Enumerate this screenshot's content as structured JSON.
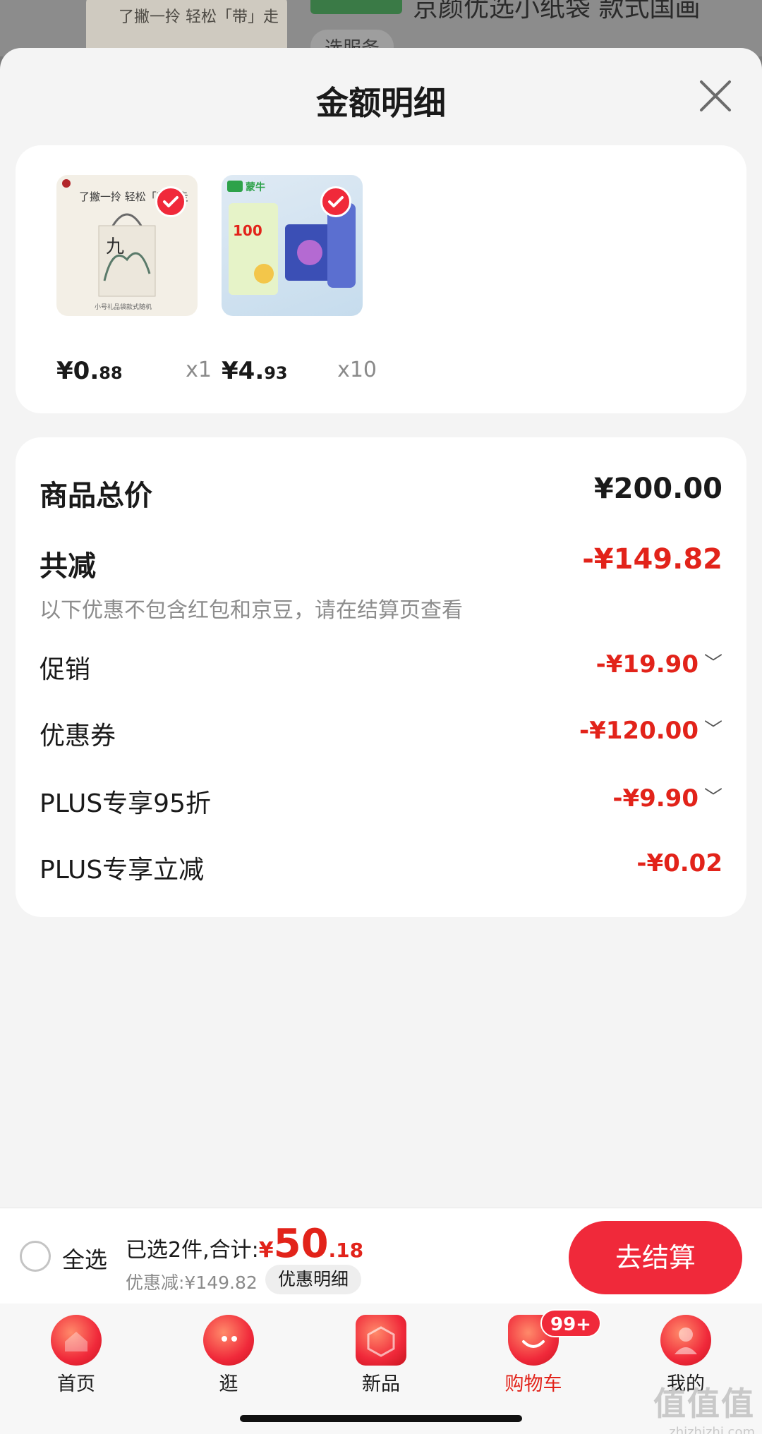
{
  "background_page": {
    "thumb_text": "了撇一拎 轻松「带」走",
    "product_title": "京颜优选小纸袋 款式国画",
    "spec_chip": "选服务"
  },
  "sheet": {
    "title": "金额明细",
    "close_icon": "close-icon"
  },
  "products": [
    {
      "image_text": "了撇一拎 轻松「带」走",
      "image_caption": "小号礼品袋款式随机",
      "price_int": "¥0.",
      "price_dec": "88",
      "qty": "x1",
      "checked": true
    },
    {
      "image_text": "蒙牛",
      "image_caption": "100",
      "price_int": "¥4.",
      "price_dec": "93",
      "qty": "x10",
      "checked": true
    }
  ],
  "breakdown": {
    "total_label": "商品总价",
    "total_value": "¥200.00",
    "reduce_label": "共减",
    "reduce_value": "-¥149.82",
    "note": "以下优惠不包含红包和京豆，请在结算页查看",
    "items": [
      {
        "label": "促销",
        "value": "-¥19.90",
        "expandable": true
      },
      {
        "label": "优惠券",
        "value": "-¥120.00",
        "expandable": true
      },
      {
        "label": "PLUS专享95折",
        "value": "-¥9.90",
        "expandable": true
      },
      {
        "label": "PLUS专享立减",
        "value": "-¥0.02",
        "expandable": false
      }
    ]
  },
  "bottom_bar": {
    "select_all": "全选",
    "selected_text": "已选2件,合计:",
    "total_symbol": "¥",
    "total_int": "50",
    "total_dec": ".18",
    "discount_text": "优惠减:¥149.82",
    "detail_chip": "优惠明细",
    "checkout": "去结算"
  },
  "tabbar": {
    "tabs": [
      {
        "label": "首页",
        "icon": "home-icon",
        "active": false
      },
      {
        "label": "逛",
        "icon": "browse-icon",
        "active": false
      },
      {
        "label": "新品",
        "icon": "new-products-icon",
        "active": false
      },
      {
        "label": "购物车",
        "icon": "cart-icon",
        "active": true
      },
      {
        "label": "我的",
        "icon": "profile-icon",
        "active": false
      }
    ],
    "cart_badge": "99+"
  },
  "watermark": {
    "logo": "值值值",
    "url": "zhizhizhi.com"
  },
  "colors": {
    "accent": "#f0293a",
    "price_red": "#e2231a",
    "sheet_bg": "#f4f4f4"
  }
}
